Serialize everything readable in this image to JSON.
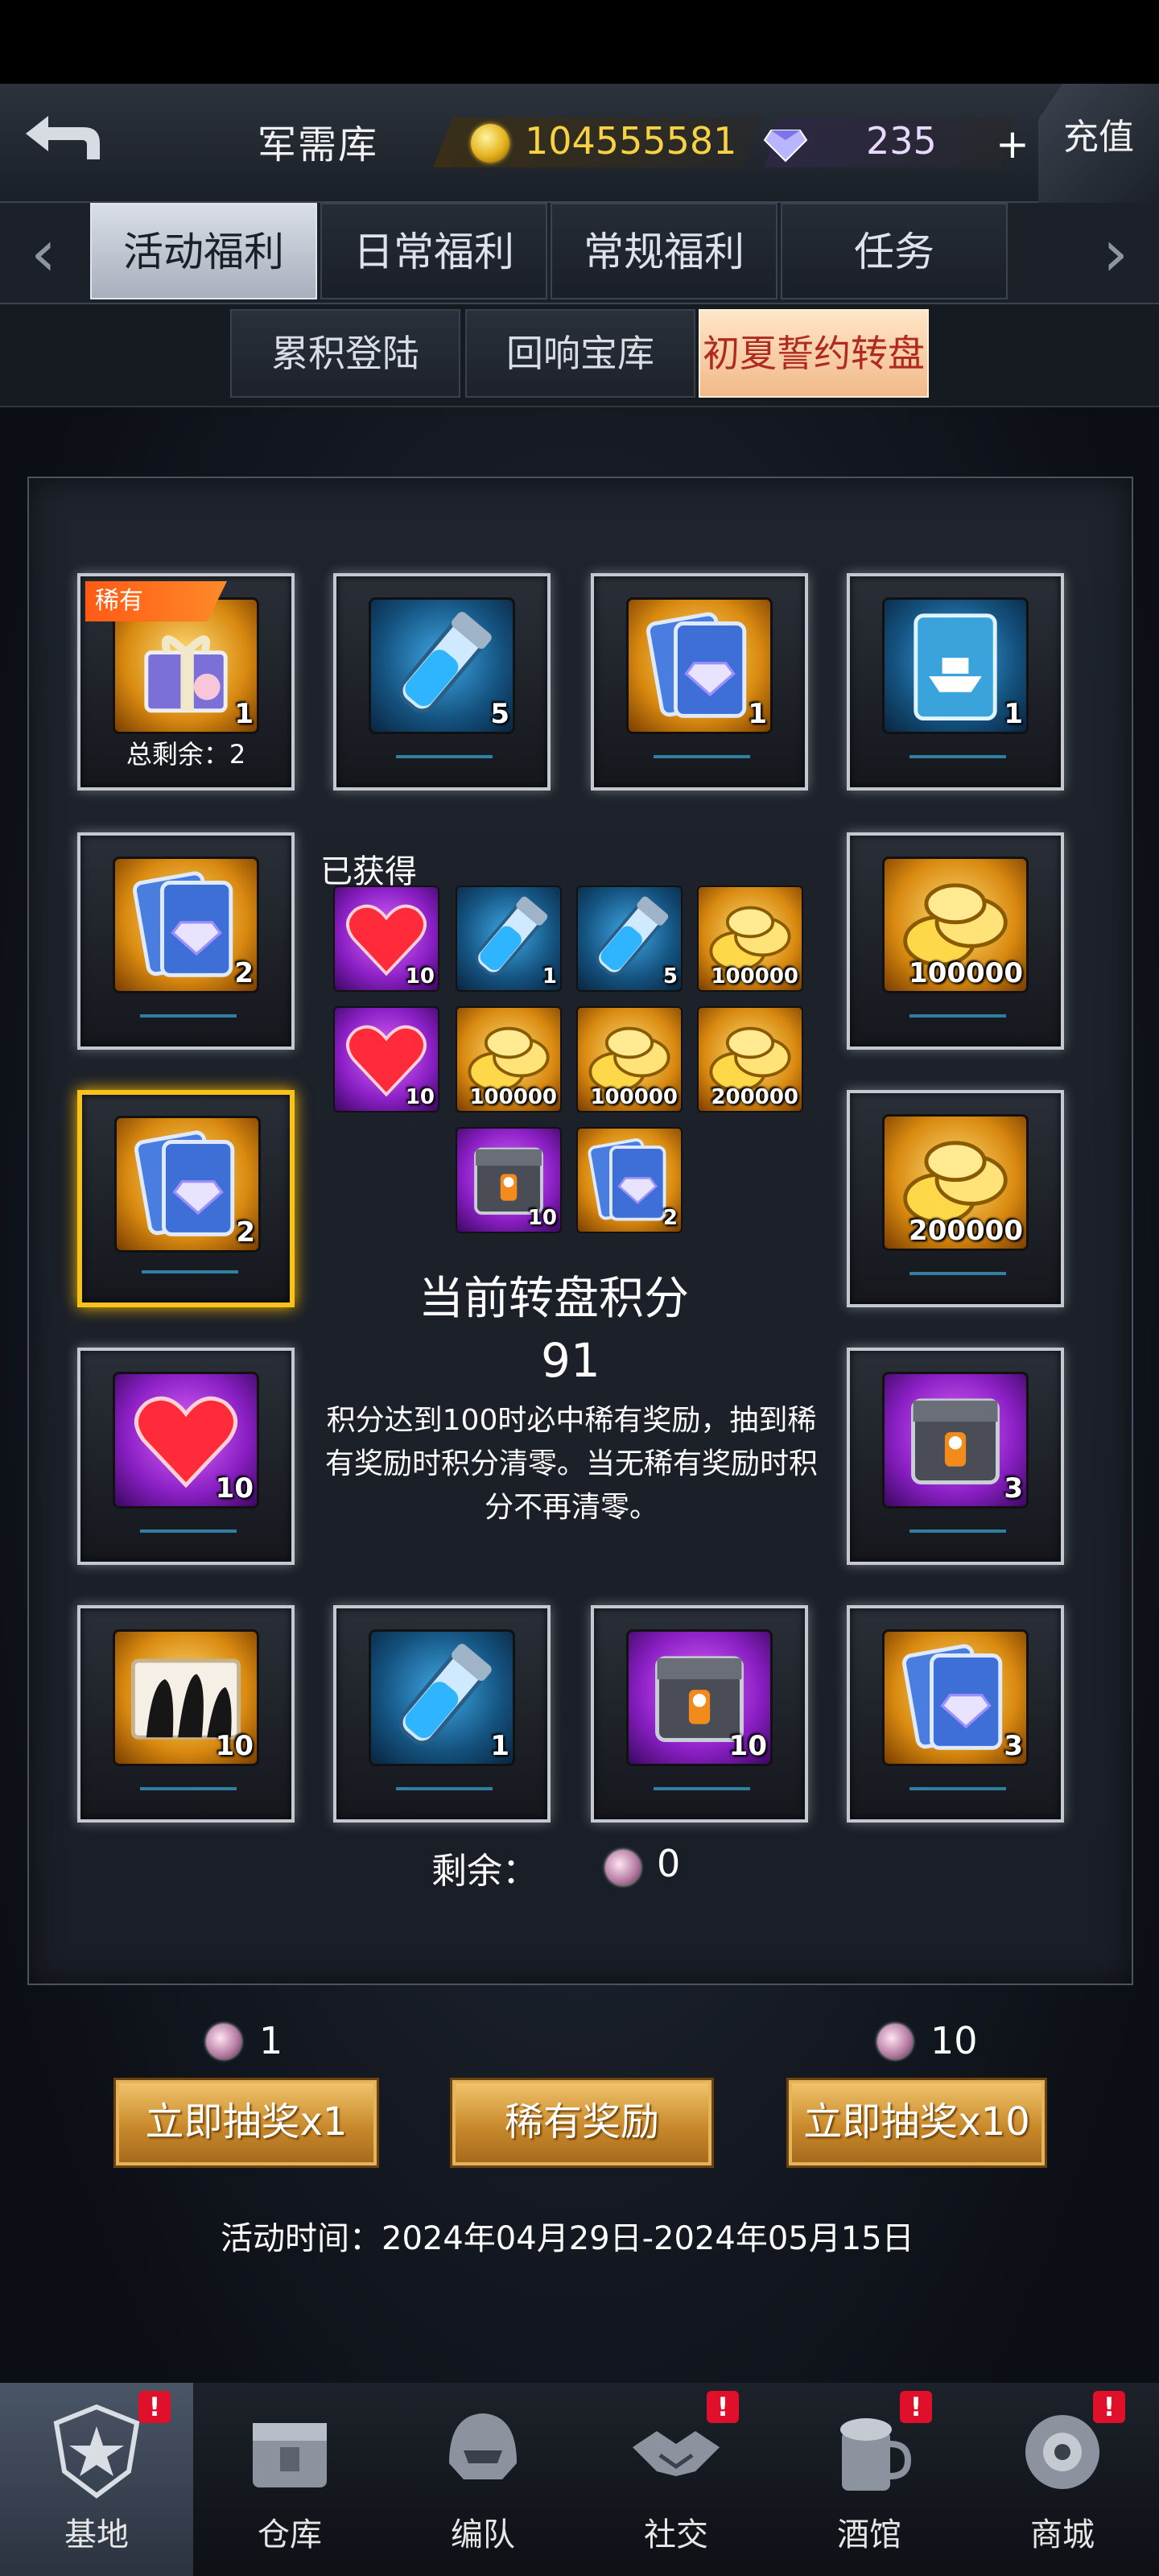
{
  "header": {
    "title": "军需库",
    "gold": "104555581",
    "gems": "235",
    "plus": "+",
    "recharge": "充值"
  },
  "tabs": [
    "活动福利",
    "日常福利",
    "常规福利",
    "任务"
  ],
  "subtabs": [
    "累积登陆",
    "回响宝库",
    "初夏誓约转盘"
  ],
  "wheel": {
    "rare_tag": "稀有",
    "total_remaining": "总剩余：2",
    "tiles": [
      {
        "kind": "gift-box",
        "qty": "1"
      },
      {
        "kind": "blue-vial",
        "qty": "5"
      },
      {
        "kind": "diamond-card",
        "qty": "1"
      },
      {
        "kind": "ship-card",
        "qty": "1"
      },
      {
        "kind": "diamond-card",
        "qty": "2"
      },
      {
        "kind": "gold-coins",
        "qty": "100000"
      },
      {
        "kind": "diamond-card",
        "qty": "2"
      },
      {
        "kind": "gold-coins",
        "qty": "200000"
      },
      {
        "kind": "heart",
        "qty": "10"
      },
      {
        "kind": "supply-crate",
        "qty": "3"
      },
      {
        "kind": "silhouette-card",
        "qty": "10"
      },
      {
        "kind": "blue-vial",
        "qty": "1"
      },
      {
        "kind": "supply-crate",
        "qty": "10"
      },
      {
        "kind": "diamond-card",
        "qty": "3"
      }
    ]
  },
  "obtained": {
    "label": "已获得",
    "items": [
      {
        "kind": "heart",
        "qty": "10"
      },
      {
        "kind": "blue-vial",
        "qty": "1"
      },
      {
        "kind": "blue-vial",
        "qty": "5"
      },
      {
        "kind": "gold-coins",
        "qty": "100000"
      },
      {
        "kind": "heart",
        "qty": "10"
      },
      {
        "kind": "gold-coins",
        "qty": "100000"
      },
      {
        "kind": "gold-coins",
        "qty": "100000"
      },
      {
        "kind": "gold-coins",
        "qty": "200000"
      },
      {
        "kind": "supply-crate",
        "qty": "10"
      },
      {
        "kind": "diamond-card",
        "qty": "2"
      }
    ]
  },
  "score": {
    "title": "当前转盘积分",
    "value": "91",
    "desc": "积分达到100时必中稀有奖励，抽到稀有奖励时积分清零。当无稀有奖励时积分不再清零。"
  },
  "remaining": {
    "label": "剩余：",
    "value": "0"
  },
  "costs": {
    "single": "1",
    "ten": "10"
  },
  "buttons": {
    "draw1": "立即抽奖x1",
    "rare": "稀有奖励",
    "draw10": "立即抽奖x10"
  },
  "event_time": "活动时间：2024年04月29日-2024年05月15日",
  "nav": [
    {
      "label": "基地",
      "icon": "star-emblem-icon",
      "badge": "!"
    },
    {
      "label": "仓库",
      "icon": "crate-icon",
      "badge": ""
    },
    {
      "label": "编队",
      "icon": "helmet-icon",
      "badge": ""
    },
    {
      "label": "社交",
      "icon": "handshake-icon",
      "badge": "!"
    },
    {
      "label": "酒馆",
      "icon": "tavern-icon",
      "badge": "!"
    },
    {
      "label": "商城",
      "icon": "shop-icon",
      "badge": "!"
    }
  ]
}
